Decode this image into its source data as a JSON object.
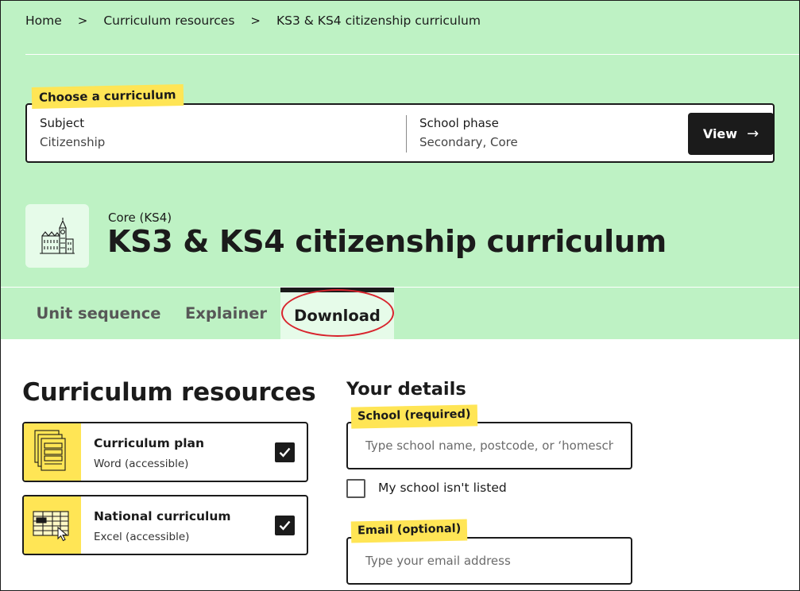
{
  "breadcrumb": {
    "items": [
      "Home",
      "Curriculum resources",
      "KS3 & KS4 citizenship curriculum"
    ],
    "separator": ">"
  },
  "picker": {
    "tag": "Choose a curriculum",
    "subject_label": "Subject",
    "subject_value": "Citizenship",
    "phase_label": "School phase",
    "phase_value": "Secondary, Core",
    "view_label": "View",
    "view_arrow": "→"
  },
  "header": {
    "eyebrow": "Core (KS4)",
    "title": "KS3 & KS4 citizenship curriculum",
    "icon": "big-ben-parliament-icon"
  },
  "tabs": [
    {
      "label": "Unit sequence",
      "active": false
    },
    {
      "label": "Explainer",
      "active": false
    },
    {
      "label": "Download",
      "active": true
    }
  ],
  "resources": {
    "title": "Curriculum resources",
    "items": [
      {
        "name": "Curriculum plan",
        "format": "Word (accessible)",
        "checked": true,
        "icon": "document-stack-icon"
      },
      {
        "name": "National curriculum",
        "format": "Excel (accessible)",
        "checked": true,
        "icon": "spreadsheet-cursor-icon"
      }
    ]
  },
  "details": {
    "title": "Your details",
    "school_tag": "School (required)",
    "school_placeholder": "Type school name, postcode, or ‘homeschool’",
    "unlisted_label": "My school isn't listed",
    "email_tag": "Email (optional)",
    "email_placeholder": "Type your email address"
  },
  "colors": {
    "hero_bg": "#bef2c4",
    "highlight_yellow": "#ffe555",
    "annotation_ring": "#d8242d",
    "dark": "#1b1b1b"
  }
}
